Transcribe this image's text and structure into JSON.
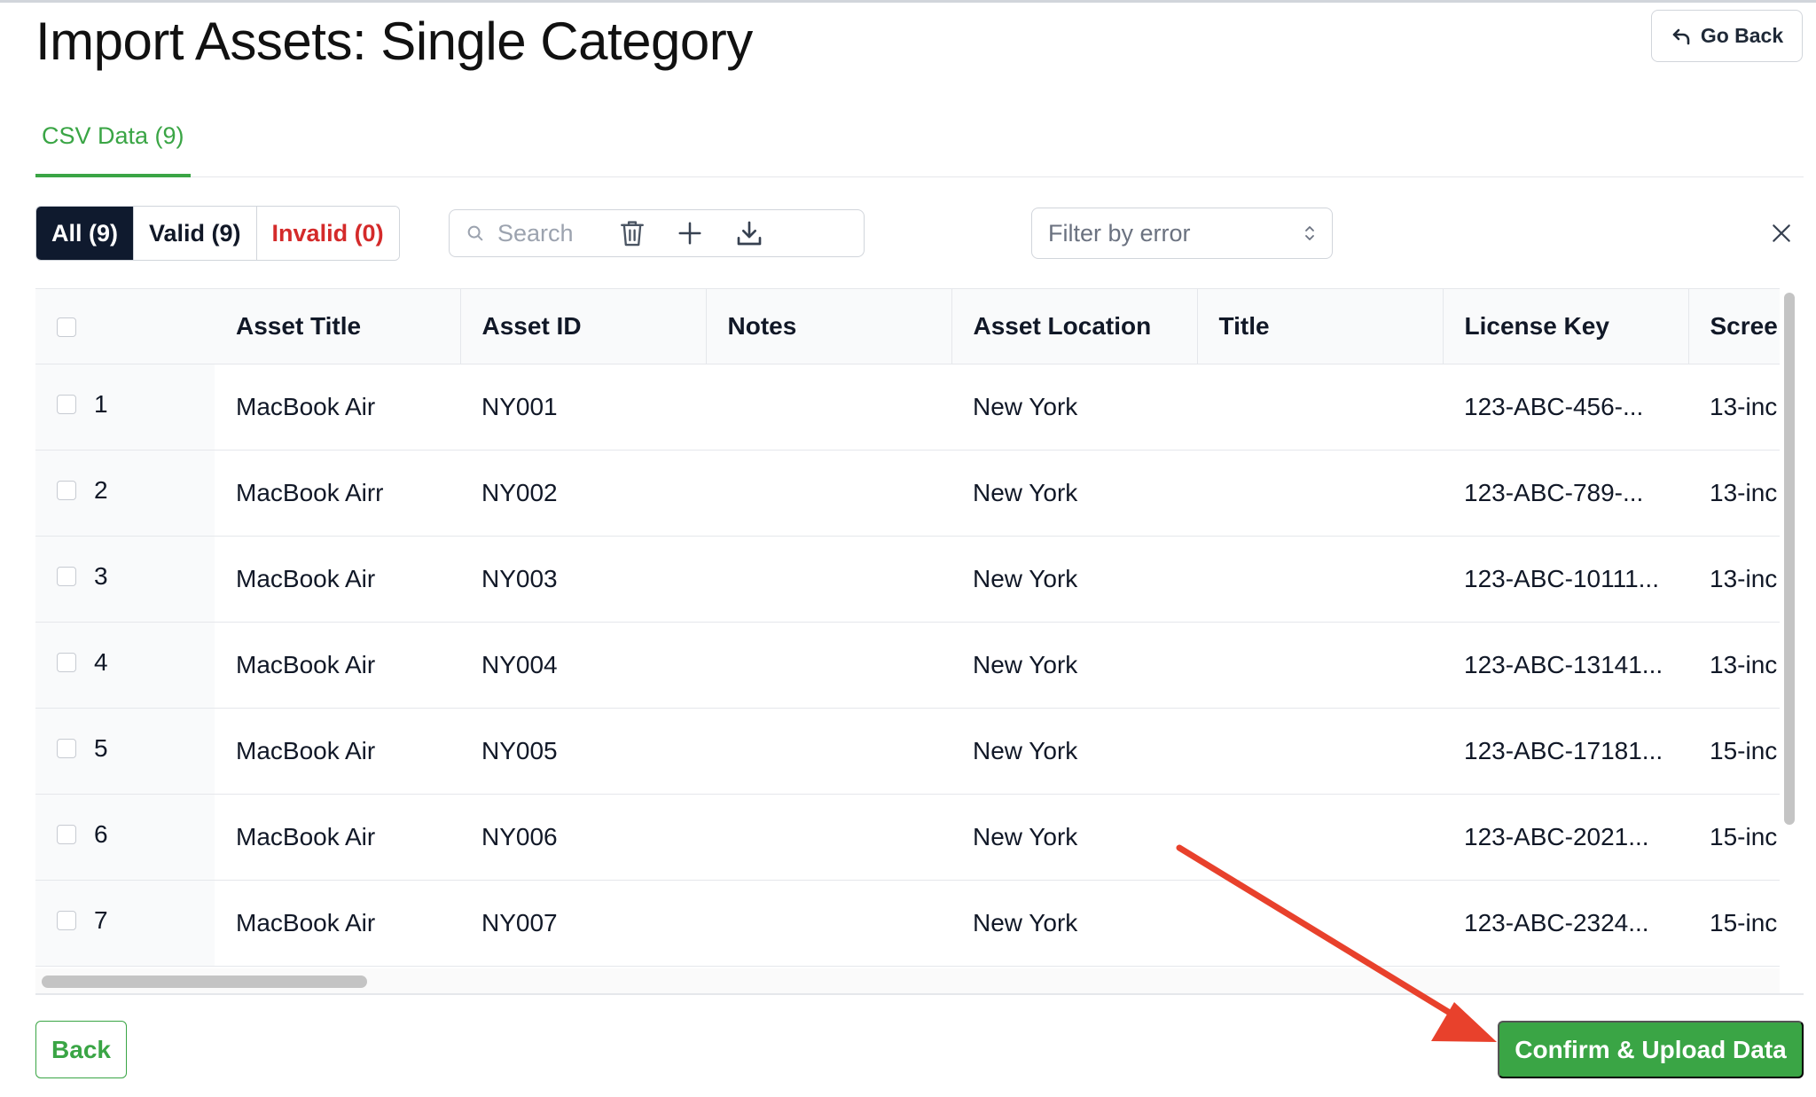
{
  "header": {
    "title": "Import Assets: Single Category",
    "go_back_label": "Go Back"
  },
  "tabs": [
    {
      "label": "CSV Data (9)",
      "active": true
    }
  ],
  "toolbar": {
    "segments": [
      {
        "label": "All (9)",
        "active": true
      },
      {
        "label": "Valid (9)",
        "active": false
      },
      {
        "label": "Invalid (0)",
        "active": false,
        "color": "#d42a2a"
      }
    ],
    "search_placeholder": "Search",
    "filter_placeholder": "Filter by error",
    "icons": [
      "trash-icon",
      "plus-icon",
      "download-icon",
      "close-icon"
    ]
  },
  "table": {
    "columns": [
      "Asset Title",
      "Asset ID",
      "Notes",
      "Asset Location",
      "Title",
      "License Key",
      "Scree"
    ],
    "rows": [
      {
        "idx": "1",
        "cells": [
          "MacBook Air",
          "NY001",
          "",
          "New York",
          "",
          "123-ABC-456-...",
          "13-inc"
        ]
      },
      {
        "idx": "2",
        "cells": [
          "MacBook Airr",
          "NY002",
          "",
          "New York",
          "",
          "123-ABC-789-...",
          "13-inc"
        ]
      },
      {
        "idx": "3",
        "cells": [
          "MacBook Air",
          "NY003",
          "",
          "New York",
          "",
          "123-ABC-10111...",
          "13-inc"
        ]
      },
      {
        "idx": "4",
        "cells": [
          "MacBook Air",
          "NY004",
          "",
          "New York",
          "",
          "123-ABC-13141...",
          "13-inc"
        ]
      },
      {
        "idx": "5",
        "cells": [
          "MacBook Air",
          "NY005",
          "",
          "New York",
          "",
          "123-ABC-17181...",
          "15-inc"
        ]
      },
      {
        "idx": "6",
        "cells": [
          "MacBook Air",
          "NY006",
          "",
          "New York",
          "",
          "123-ABC-2021...",
          "15-inc"
        ]
      },
      {
        "idx": "7",
        "cells": [
          "MacBook Air",
          "NY007",
          "",
          "New York",
          "",
          "123-ABC-2324...",
          "15-inc"
        ]
      }
    ]
  },
  "footer": {
    "back_label": "Back",
    "confirm_label": "Confirm & Upload Data"
  },
  "colors": {
    "accent_green": "#3aa545",
    "active_segment": "#0f1a2e",
    "invalid_red": "#d42a2a",
    "annotation_arrow": "#e8412c"
  }
}
